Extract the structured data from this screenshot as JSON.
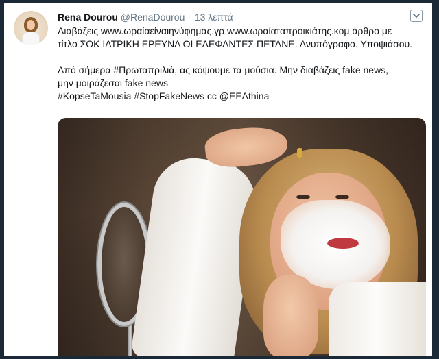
{
  "tweet": {
    "author_name": "Rena Dourou",
    "author_handle": "@RenaDourou",
    "separator": "·",
    "time": "13 λεπτά",
    "lines": [
      "Διαβάζεις www.ωραίαείναιηνύφημας.γρ www.ωραίαταπροικιάτης.κομ άρθρο με",
      "τίτλο ΣΟΚ ΙΑΤΡΙΚΗ ΕΡΕΥΝΑ ΟΙ ΕΛΕΦΑΝΤΕΣ ΠΕΤΑΝΕ. Ανυπόγραφο. Υποψιάσου.",
      "Από σήμερα #Πρωταπριλιά, ας κόψουμε τα μούσια. Μην διαβάζεις fake news,",
      "μην μοιράζεσαι fake news",
      "#KopseTaMousia #StopFakeNews cc @EEAthina"
    ]
  },
  "icons": {
    "caret": "chevron-down-icon",
    "avatar": "avatar"
  },
  "colors": {
    "page_background": "#1b2836",
    "card_background": "#ffffff",
    "name": "#14171a",
    "meta": "#657786"
  }
}
